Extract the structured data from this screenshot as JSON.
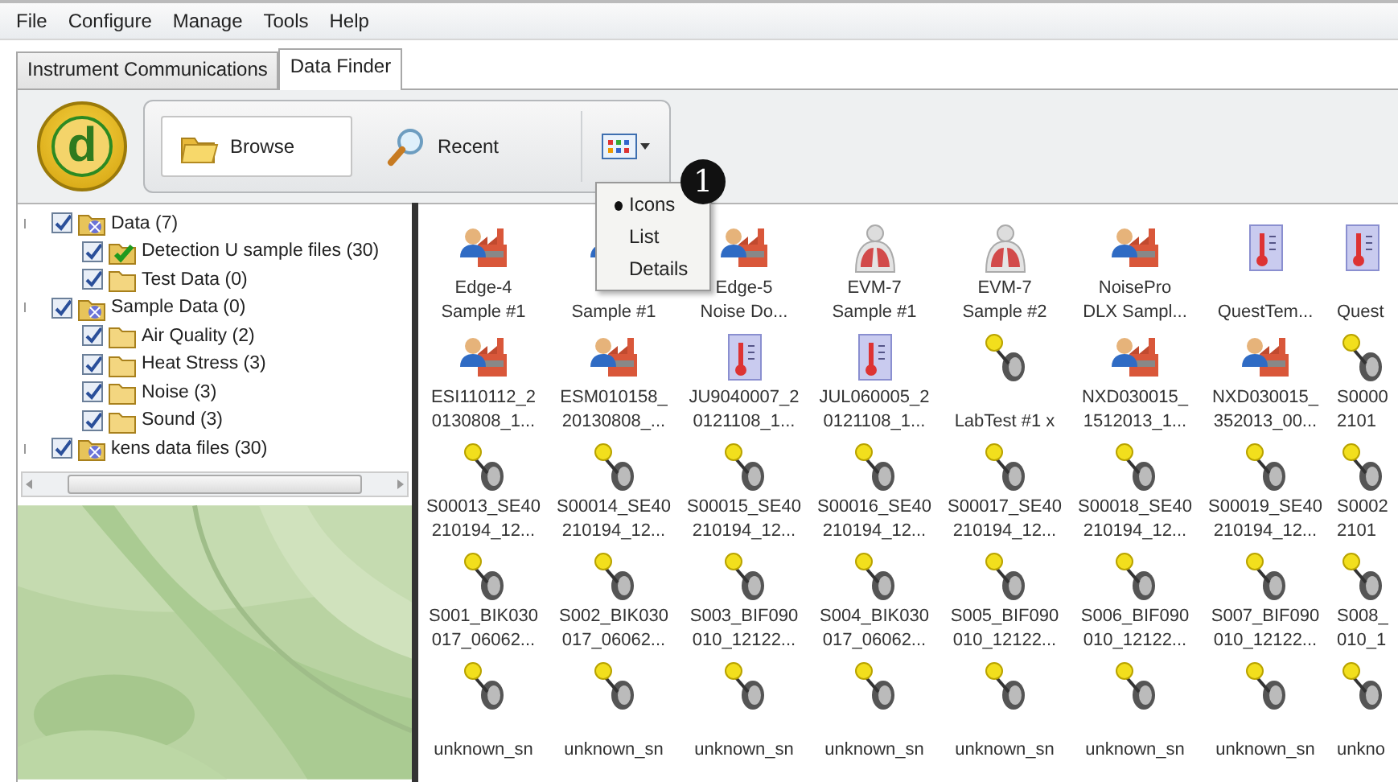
{
  "menu_bar": [
    "File",
    "Configure",
    "Manage",
    "Tools",
    "Help"
  ],
  "tabs": [
    {
      "label": "Instrument Communications",
      "selected": false
    },
    {
      "label": "Data Finder",
      "selected": true
    }
  ],
  "toolbar": {
    "logo_text": "d",
    "buttons": [
      {
        "label": "Browse",
        "kind": "browse"
      },
      {
        "label": "Recent",
        "kind": "recent"
      }
    ]
  },
  "view_menu": {
    "items": [
      {
        "label": "Icons",
        "selected": true
      },
      {
        "label": "List",
        "selected": false
      },
      {
        "label": "Details",
        "selected": false
      }
    ],
    "callout": "1"
  },
  "tree": [
    {
      "label": "Data (7)",
      "kind": "source",
      "checked": true,
      "children": [
        {
          "label": "Detection U sample files (30)",
          "kind": "marked-folder",
          "checked": true
        },
        {
          "label": "Test Data (0)",
          "kind": "folder",
          "checked": true
        }
      ]
    },
    {
      "label": "Sample Data (0)",
      "kind": "source",
      "checked": true,
      "children": [
        {
          "label": "Air Quality (2)",
          "kind": "folder",
          "checked": true
        },
        {
          "label": "Heat Stress (3)",
          "kind": "folder",
          "checked": true
        },
        {
          "label": "Noise (3)",
          "kind": "folder",
          "checked": true
        },
        {
          "label": "Sound (3)",
          "kind": "folder",
          "checked": true
        }
      ]
    },
    {
      "label": "kens data files (30)",
      "kind": "source",
      "checked": true
    }
  ],
  "files": [
    {
      "kind": "factory",
      "lines": [
        "Edge-4",
        "Sample #1"
      ]
    },
    {
      "kind": "factory",
      "lines": [
        "Sample #1"
      ]
    },
    {
      "kind": "factory",
      "lines": [
        "Edge-5",
        "Noise Do..."
      ]
    },
    {
      "kind": "lungs",
      "lines": [
        "EVM-7",
        "Sample #1"
      ]
    },
    {
      "kind": "lungs",
      "lines": [
        "EVM-7",
        "Sample #2"
      ]
    },
    {
      "kind": "factory",
      "lines": [
        "NoisePro",
        "DLX Sampl..."
      ]
    },
    {
      "kind": "thermometer",
      "lines": [
        "QuestTem..."
      ]
    },
    {
      "kind": "thermometer",
      "lines": [
        "Quest"
      ]
    },
    {
      "kind": "factory",
      "lines": [
        "ESI110112_2",
        "0130808_1..."
      ]
    },
    {
      "kind": "factory",
      "lines": [
        "ESM010158_",
        "20130808_..."
      ]
    },
    {
      "kind": "thermometer",
      "lines": [
        "JU9040007_2",
        "0121108_1..."
      ]
    },
    {
      "kind": "thermometer",
      "lines": [
        "JUL060005_2",
        "0121108_1..."
      ]
    },
    {
      "kind": "microphone",
      "lines": [
        "LabTest #1 x"
      ]
    },
    {
      "kind": "factory",
      "lines": [
        "NXD030015_",
        "1512013_1..."
      ]
    },
    {
      "kind": "factory",
      "lines": [
        "NXD030015_",
        "352013_00..."
      ]
    },
    {
      "kind": "microphone",
      "lines": [
        "S0000",
        "2101"
      ]
    },
    {
      "kind": "microphone",
      "lines": [
        "S00013_SE40",
        "210194_12..."
      ]
    },
    {
      "kind": "microphone",
      "lines": [
        "S00014_SE40",
        "210194_12..."
      ]
    },
    {
      "kind": "microphone",
      "lines": [
        "S00015_SE40",
        "210194_12..."
      ]
    },
    {
      "kind": "microphone",
      "lines": [
        "S00016_SE40",
        "210194_12..."
      ]
    },
    {
      "kind": "microphone",
      "lines": [
        "S00017_SE40",
        "210194_12..."
      ]
    },
    {
      "kind": "microphone",
      "lines": [
        "S00018_SE40",
        "210194_12..."
      ]
    },
    {
      "kind": "microphone",
      "lines": [
        "S00019_SE40",
        "210194_12..."
      ]
    },
    {
      "kind": "microphone",
      "lines": [
        "S0002",
        "2101"
      ]
    },
    {
      "kind": "microphone",
      "lines": [
        "S001_BIK030",
        "017_06062..."
      ]
    },
    {
      "kind": "microphone",
      "lines": [
        "S002_BIK030",
        "017_06062..."
      ]
    },
    {
      "kind": "microphone",
      "lines": [
        "S003_BIF090",
        "010_12122..."
      ]
    },
    {
      "kind": "microphone",
      "lines": [
        "S004_BIK030",
        "017_06062..."
      ]
    },
    {
      "kind": "microphone",
      "lines": [
        "S005_BIF090",
        "010_12122..."
      ]
    },
    {
      "kind": "microphone",
      "lines": [
        "S006_BIF090",
        "010_12122..."
      ]
    },
    {
      "kind": "microphone",
      "lines": [
        "S007_BIF090",
        "010_12122..."
      ]
    },
    {
      "kind": "microphone",
      "lines": [
        "S008_",
        "010_1"
      ]
    },
    {
      "kind": "microphone",
      "lines": [
        "unknown_sn"
      ]
    },
    {
      "kind": "microphone",
      "lines": [
        "unknown_sn"
      ]
    },
    {
      "kind": "microphone",
      "lines": [
        "unknown_sn"
      ]
    },
    {
      "kind": "microphone",
      "lines": [
        "unknown_sn"
      ]
    },
    {
      "kind": "microphone",
      "lines": [
        "unknown_sn"
      ]
    },
    {
      "kind": "microphone",
      "lines": [
        "unknown_sn"
      ]
    },
    {
      "kind": "microphone",
      "lines": [
        "unknown_sn"
      ]
    },
    {
      "kind": "microphone",
      "lines": [
        "unkno"
      ]
    }
  ]
}
